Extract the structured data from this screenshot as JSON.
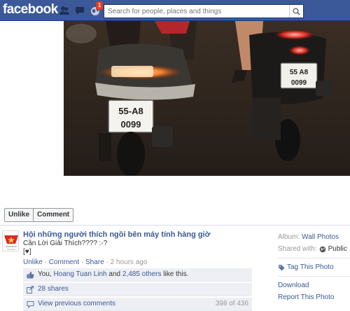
{
  "header": {
    "logo": "facebook",
    "notification_count": "1",
    "search_placeholder": "Search for people, places and things"
  },
  "photo": {
    "left_plate": {
      "line1": "55-A8",
      "line2": "0099"
    },
    "right_plate": {
      "line1": "55 A8",
      "line2": "0099"
    }
  },
  "actions": {
    "unlike": "Unlike",
    "comment": "Comment"
  },
  "post": {
    "author": "Hội những người thích ngồi bên máy tính hàng giờ",
    "text": "Cần Lời Giải Thích???? :-?",
    "text2": "[♥]",
    "meta": {
      "unlike": "Unlike",
      "comment": "Comment",
      "share": "Share",
      "sep": "·",
      "time": "2 hours ago"
    }
  },
  "ufi": {
    "likes": {
      "you": "You,",
      "friend": "Hoang Tuan Linh",
      "and": "and",
      "others": "2,485 others",
      "tail": "like this."
    },
    "shares": "28 shares",
    "comments": {
      "label": "View previous comments",
      "count": "398 of 436"
    }
  },
  "sidebar": {
    "album_label": "Album:",
    "album_value": "Wall Photos",
    "shared_label": "Shared with:",
    "shared_value": "Public",
    "tag": "Tag This Photo",
    "download": "Download",
    "report": "Report This Photo"
  },
  "colors": {
    "brand": "#3b5998",
    "badge": "#f03d25",
    "ufi_bg": "#edeff4"
  }
}
